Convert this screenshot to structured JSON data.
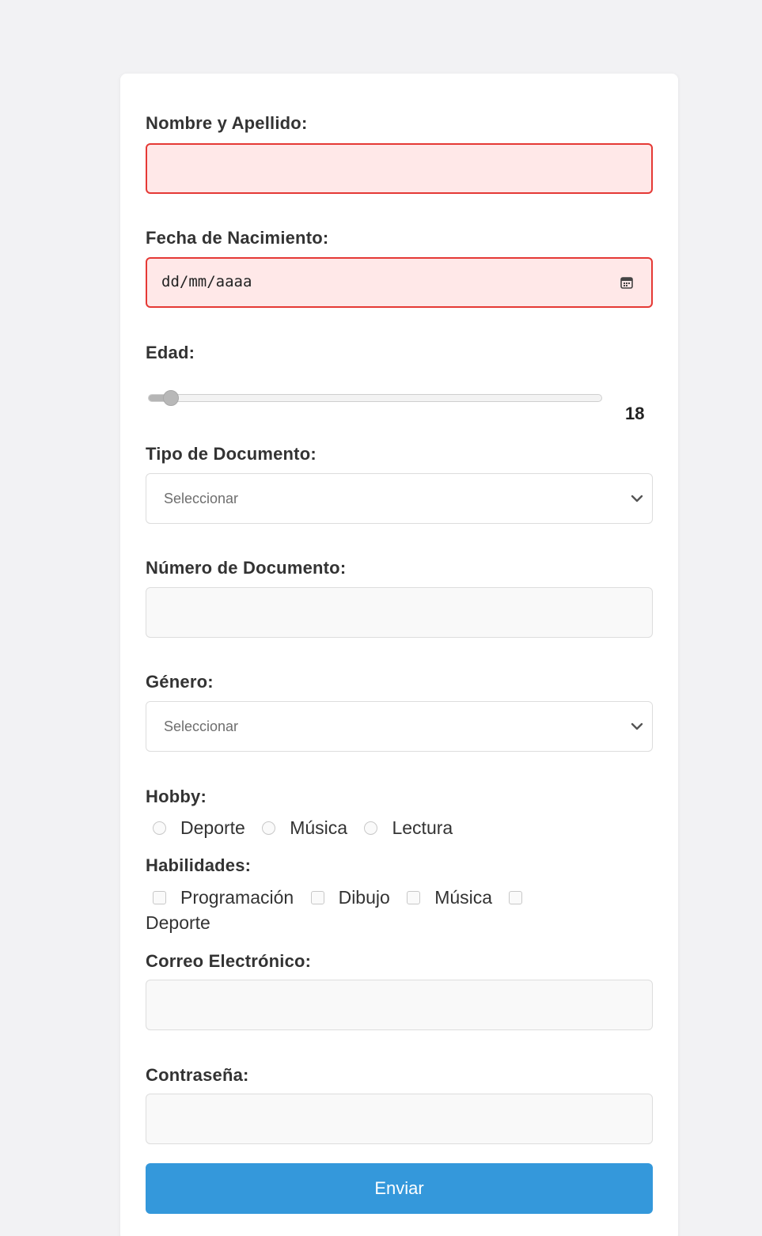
{
  "form": {
    "name_label": "Nombre y Apellido:",
    "name_value": "",
    "birthdate_label": "Fecha de Nacimiento:",
    "birthdate_placeholder": "dd/mm/aaaa",
    "age_label": "Edad:",
    "age_value": "18",
    "age_fill_fraction": 0.05,
    "doc_type_label": "Tipo de Documento:",
    "doc_type_selected": "Seleccionar",
    "doc_number_label": "Número de Documento:",
    "doc_number_value": "",
    "gender_label": "Género:",
    "gender_selected": "Seleccionar",
    "hobby_label": "Hobby:",
    "hobby_options": [
      "Deporte",
      "Música",
      "Lectura"
    ],
    "skills_label": "Habilidades:",
    "skills_options": [
      "Programación",
      "Dibujo",
      "Música",
      "Deporte"
    ],
    "email_label": "Correo Electrónico:",
    "email_value": "",
    "password_label": "Contraseña:",
    "password_value": "",
    "submit_label": "Enviar"
  },
  "icons": {
    "date": "calendar-icon",
    "select": "chevron-down-icon"
  },
  "colors": {
    "error_border": "#e53935",
    "error_background": "#ffe8e8",
    "submit_background": "#3498db",
    "page_background": "#f2f2f4"
  }
}
